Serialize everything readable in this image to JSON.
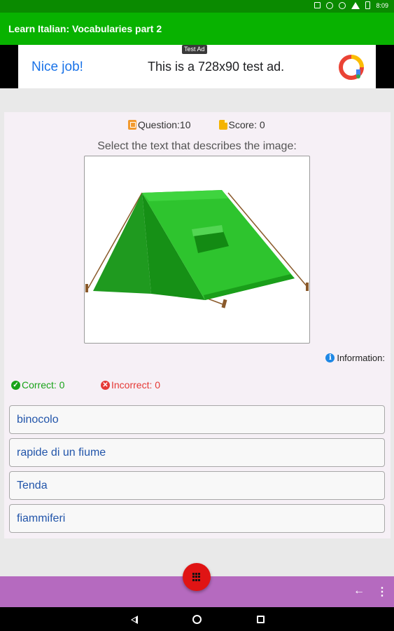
{
  "status_bar": {
    "time": "8:09"
  },
  "app_bar": {
    "title": "Learn Italian: Vocabularies part 2"
  },
  "ad": {
    "label": "Test Ad",
    "headline": "Nice job!",
    "text": "This is a 728x90 test ad."
  },
  "quiz": {
    "question_label": "Question:10",
    "score_label": "Score: 0",
    "prompt": "Select the text that describes the image:",
    "image_icon": "tent-image",
    "information_label": "Information:",
    "correct_label": "Correct: 0",
    "incorrect_label": "Incorrect: 0",
    "answers": [
      {
        "label": "binocolo"
      },
      {
        "label": "rapide di un fiume"
      },
      {
        "label": "Tenda"
      },
      {
        "label": "fiammiferi"
      }
    ]
  },
  "colors": {
    "status_bar": "#0a8a00",
    "app_bar": "#08b200",
    "bottom_bar": "#b56abf",
    "fab": "#e01414",
    "answer_text": "#2255aa",
    "correct": "#19a319",
    "incorrect": "#e53935"
  },
  "icons": {
    "fab": "grid-icon",
    "bottom_back": "back-arrow-icon",
    "bottom_more": "more-vert-icon",
    "nav": [
      "nav-back-icon",
      "nav-home-icon",
      "nav-recents-icon"
    ]
  }
}
